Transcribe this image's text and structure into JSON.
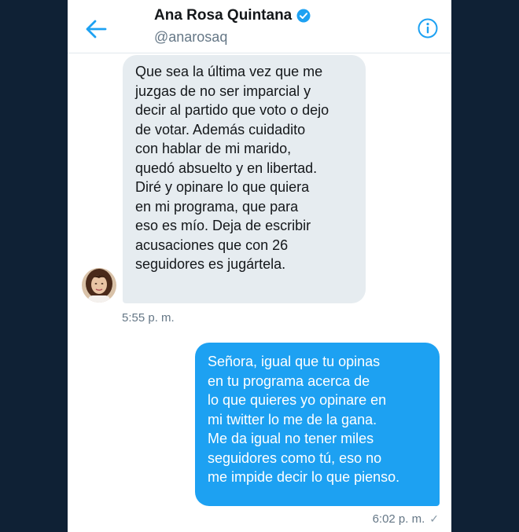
{
  "header": {
    "name": "Ana Rosa Quintana",
    "handle": "@anarosaq",
    "back_icon": "arrow-left-icon",
    "info_icon": "info-circle-icon",
    "verified_icon": "verified-badge-icon"
  },
  "messages": [
    {
      "direction": "incoming",
      "text": "Que sea la última vez que me\njuzgas de no ser imparcial y\ndecir al partido que voto o dejo\nde votar. Además cuidadito\ncon hablar de mi marido,\nquedó  absuelto y en libertad.\nDiré y opinare lo que quiera\nen mi programa, que para\neso es mío. Deja de escribir\nacusaciones que con 26\nseguidores es jugártela.",
      "time": "5:55 p. m."
    },
    {
      "direction": "outgoing",
      "text": "Señora, igual que tu opinas\nen tu programa acerca de\nlo que quieres yo opinare en\nmi twitter  lo me de la gana.\nMe da igual no tener miles\nseguidores como tú, eso no\nme impide decir lo que pienso.",
      "time": "6:02 p. m.",
      "status_icon": "check-icon"
    }
  ],
  "colors": {
    "accent": "#1da1f2",
    "incoming_bubble": "#e6ecf0",
    "background": "#0f2135"
  }
}
